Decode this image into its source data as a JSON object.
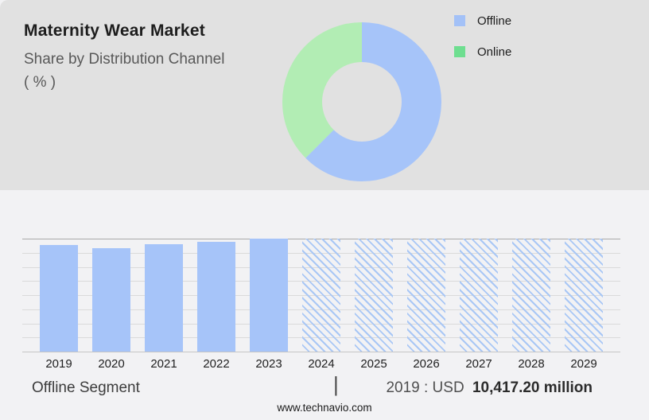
{
  "header": {
    "title": "Maternity Wear Market",
    "subtitle_line1": "Share by Distribution Channel",
    "subtitle_line2": "( % )"
  },
  "legend": {
    "items": [
      {
        "label": "Offline",
        "color": "#A3C1F7"
      },
      {
        "label": "Online",
        "color": "#6EDE90"
      }
    ]
  },
  "chart_data": [
    {
      "type": "pie",
      "variant": "donut",
      "title": "Maternity Wear Market",
      "subtitle": "Share by Distribution Channel ( % )",
      "direction": "clockwise",
      "start_angle_deg": 0,
      "inner_radius_ratio": 0.5,
      "slices": [
        {
          "name": "Offline",
          "value": 62.5,
          "color": "#A6C4F9"
        },
        {
          "name": "Online",
          "value": 37.5,
          "color": "#B2EDB4"
        }
      ],
      "legend_position": "right"
    },
    {
      "type": "bar",
      "xlabel": "",
      "ylabel": "",
      "axis_labels_hidden": true,
      "gridlines": 9,
      "grid_on": true,
      "bar_color": "#A6C4F9",
      "hatch_color": "#A9C7F5",
      "categories": [
        "2019",
        "2020",
        "2021",
        "2022",
        "2023",
        "2024",
        "2025",
        "2026",
        "2027",
        "2028",
        "2029"
      ],
      "items": [
        {
          "year": "2019",
          "height_pct": 94.4,
          "forecast": false
        },
        {
          "year": "2020",
          "height_pct": 91.5,
          "forecast": false
        },
        {
          "year": "2021",
          "height_pct": 95.1,
          "forecast": false
        },
        {
          "year": "2022",
          "height_pct": 97.2,
          "forecast": false
        },
        {
          "year": "2023",
          "height_pct": 100.0,
          "forecast": false
        },
        {
          "year": "2024",
          "height_pct": 100.0,
          "forecast": true
        },
        {
          "year": "2025",
          "height_pct": 100.0,
          "forecast": true
        },
        {
          "year": "2026",
          "height_pct": 100.0,
          "forecast": true
        },
        {
          "year": "2027",
          "height_pct": 100.0,
          "forecast": true
        },
        {
          "year": "2028",
          "height_pct": 100.0,
          "forecast": true
        },
        {
          "year": "2029",
          "height_pct": 100.0,
          "forecast": true
        }
      ],
      "annotation": {
        "year": "2019",
        "value_usd_million": "10,417.20"
      }
    }
  ],
  "bottom": {
    "segment_label": "Offline Segment",
    "separator": "|",
    "value_prefix": "2019 : USD",
    "value_bold": "10,417.20 million"
  },
  "footer": {
    "website": "www.technavio.com"
  }
}
